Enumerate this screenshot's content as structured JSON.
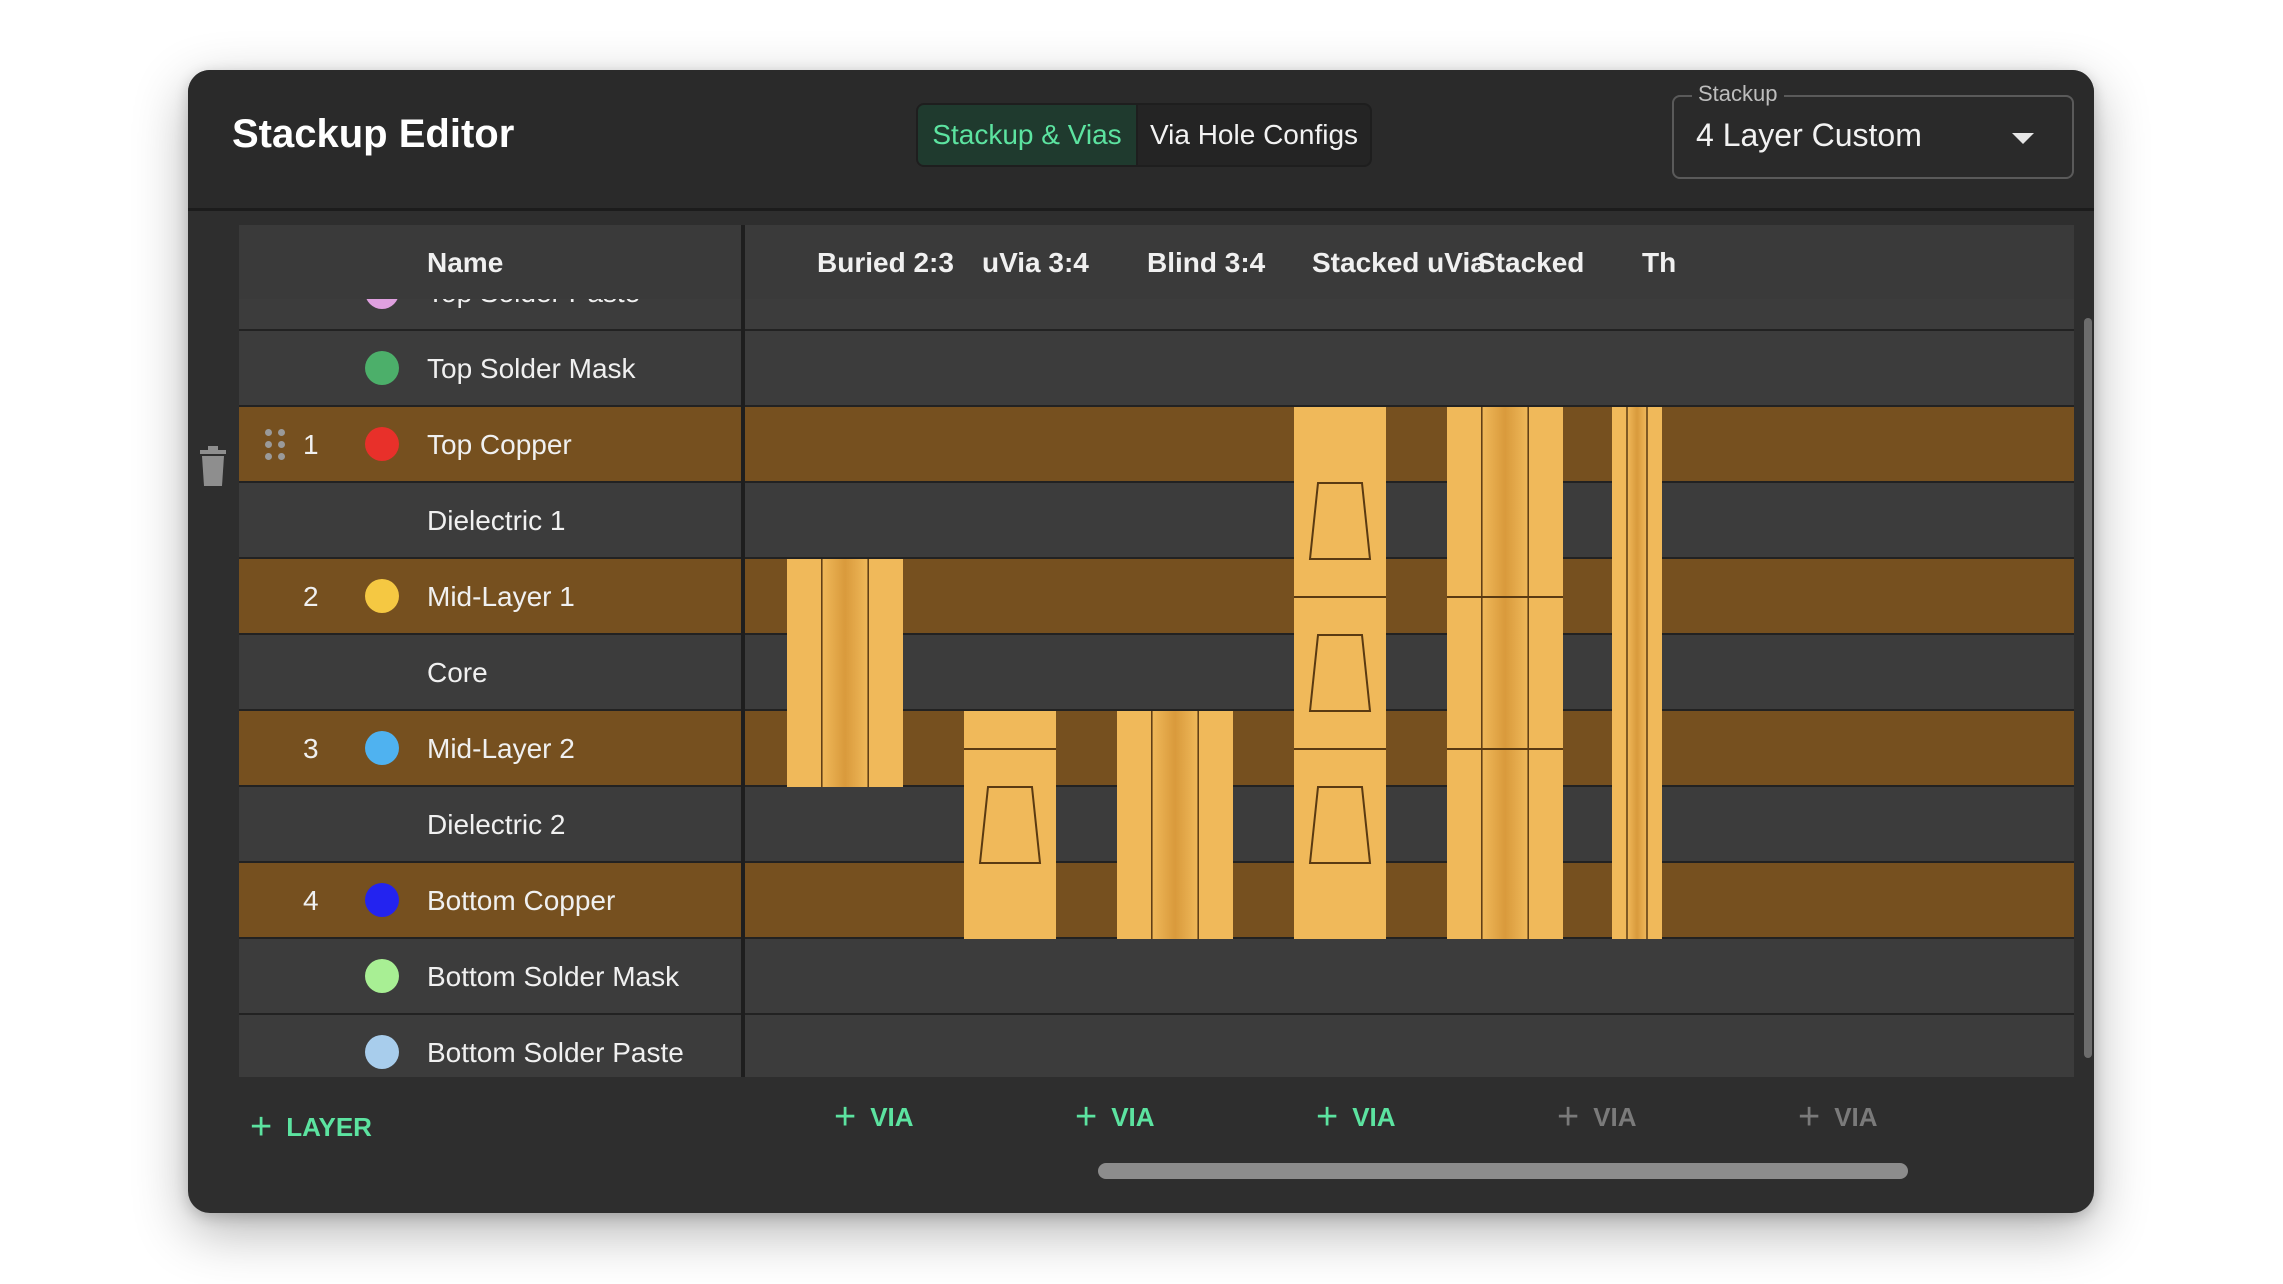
{
  "header": {
    "title": "Stackup Editor",
    "tabs": [
      {
        "label": "Stackup & Vias",
        "active": true
      },
      {
        "label": "Via Hole Configs",
        "active": false
      }
    ],
    "stackup_select": {
      "label": "Stackup",
      "value": "4 Layer Custom"
    }
  },
  "table": {
    "name_header": "Name",
    "via_headers": [
      "Buried 2:3",
      "uVia 3:4",
      "Blind 3:4",
      "Stacked uVia",
      "Stacked Blind",
      "Th"
    ],
    "layers": [
      {
        "type": "mask",
        "number": "",
        "name": "Top Solder Paste",
        "color": "#dfa0df"
      },
      {
        "type": "mask",
        "number": "",
        "name": "Top Solder Mask",
        "color": "#4caf6a"
      },
      {
        "type": "copper",
        "number": "1",
        "name": "Top Copper",
        "color": "#e8302a"
      },
      {
        "type": "dielectric",
        "number": "",
        "name": "Dielectric 1",
        "color": ""
      },
      {
        "type": "copper",
        "number": "2",
        "name": "Mid-Layer 1",
        "color": "#f5c842"
      },
      {
        "type": "dielectric",
        "number": "",
        "name": "Core",
        "color": ""
      },
      {
        "type": "copper",
        "number": "3",
        "name": "Mid-Layer 2",
        "color": "#4fb2f0"
      },
      {
        "type": "dielectric",
        "number": "",
        "name": "Dielectric 2",
        "color": ""
      },
      {
        "type": "copper",
        "number": "4",
        "name": "Bottom Copper",
        "color": "#2323f0"
      },
      {
        "type": "mask",
        "number": "",
        "name": "Bottom Solder Mask",
        "color": "#a8ef94"
      },
      {
        "type": "mask",
        "number": "",
        "name": "Bottom Solder Paste",
        "color": "#a8cdec"
      }
    ]
  },
  "footer": {
    "add_layer_label": "LAYER",
    "add_via_label": "VIA",
    "add_via_buttons": [
      {
        "enabled": true
      },
      {
        "enabled": true
      },
      {
        "enabled": true
      },
      {
        "enabled": false
      },
      {
        "enabled": false
      }
    ]
  },
  "colors": {
    "accent": "#5ce3a0",
    "copper_row": "#76501f",
    "dielectric_row": "#3c3c3c",
    "via_copper": "#f0b95a",
    "disabled": "#7a7a7a"
  }
}
